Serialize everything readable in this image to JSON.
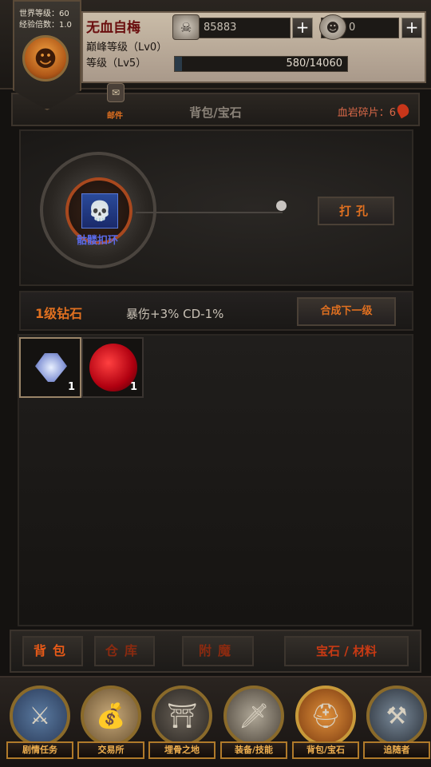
{
  "header": {
    "world_level": "世界等级：60",
    "exp_multiplier": "经验倍数：1.0",
    "player_name": "无血自梅",
    "peak_level": "巅峰等级（Lv0）",
    "level": "等级（Lv5）",
    "currency1": "85883",
    "currency2": "0",
    "exp_text": "580/14060",
    "exp_progress": 0.041
  },
  "title_bar": {
    "mail_label": "邮件",
    "title": "背包/宝石",
    "shards": "血岩碎片：6"
  },
  "socket": {
    "item_name": "骷髅扣环",
    "punch_button": "打孔"
  },
  "gem_info": {
    "name": "1级钻石",
    "effect": "暴伤+3% CD-1%",
    "merge_button": "合成下一级"
  },
  "inventory": {
    "slots": [
      {
        "icon": "diamond-gem-icon",
        "count": "1"
      },
      {
        "icon": "ruby-gem-icon",
        "count": "1"
      }
    ]
  },
  "tabs": {
    "backpack": "背包",
    "warehouse": "仓库",
    "enchant": "附魔",
    "gems_materials": "宝石 / 材料"
  },
  "nav": {
    "story": "剧情任务",
    "trade": "交易所",
    "bones": "埋骨之地",
    "equip": "装备/技能",
    "bag": "背包/宝石",
    "hunter": "追随者"
  }
}
